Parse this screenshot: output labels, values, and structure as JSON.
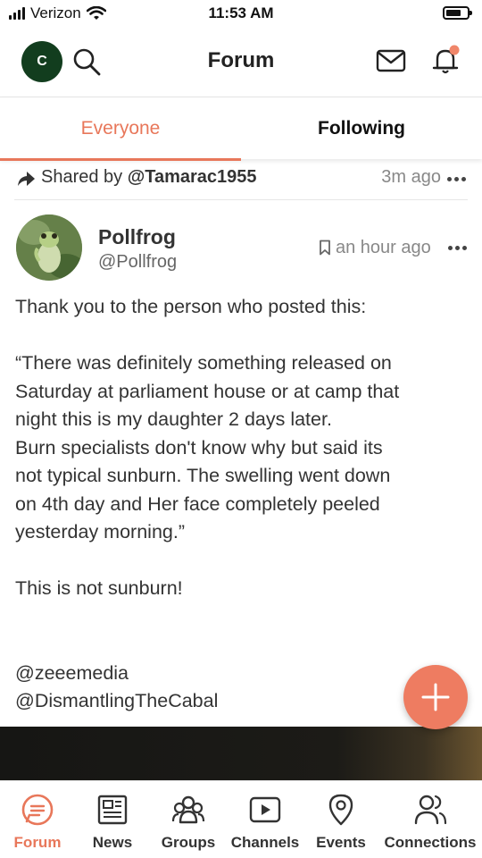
{
  "status_bar": {
    "carrier": "Verizon",
    "time": "11:53 AM"
  },
  "header": {
    "avatar_letter": "C",
    "title": "Forum"
  },
  "tabs": [
    {
      "label": "Everyone",
      "active": true
    },
    {
      "label": "Following",
      "active": false
    }
  ],
  "shared": {
    "prefix": "Shared by",
    "user": "@Tamarac1955",
    "time": "3m ago"
  },
  "post": {
    "author_name": "Pollfrog",
    "author_handle": "@Pollfrog",
    "time": "an hour ago",
    "lines": [
      "Thank you to the person who posted this:",
      "",
      "“There was definitely something released on",
      "Saturday at parliament house or at camp that",
      "night this is my daughter 2 days later.",
      "Burn specialists don't know why but said its",
      "not typical sunburn. The swelling went down",
      "on 4th day and Her face completely peeled",
      "yesterday morning.”",
      "",
      "This is not sunburn!",
      "",
      "",
      "@zeeemedia",
      "@DismantlingTheCabal"
    ]
  },
  "bottom_nav": [
    {
      "label": "Forum",
      "icon": "forum-icon",
      "active": true
    },
    {
      "label": "News",
      "icon": "news-icon"
    },
    {
      "label": "Groups",
      "icon": "groups-icon"
    },
    {
      "label": "Channels",
      "icon": "channels-icon"
    },
    {
      "label": "Events",
      "icon": "events-icon"
    },
    {
      "label": "Connections",
      "icon": "connections-icon"
    }
  ],
  "colors": {
    "accent": "#e8775a",
    "fab": "#ee7c61",
    "avatar_bg": "#123d1e",
    "notification_dot": "#f0866a"
  }
}
